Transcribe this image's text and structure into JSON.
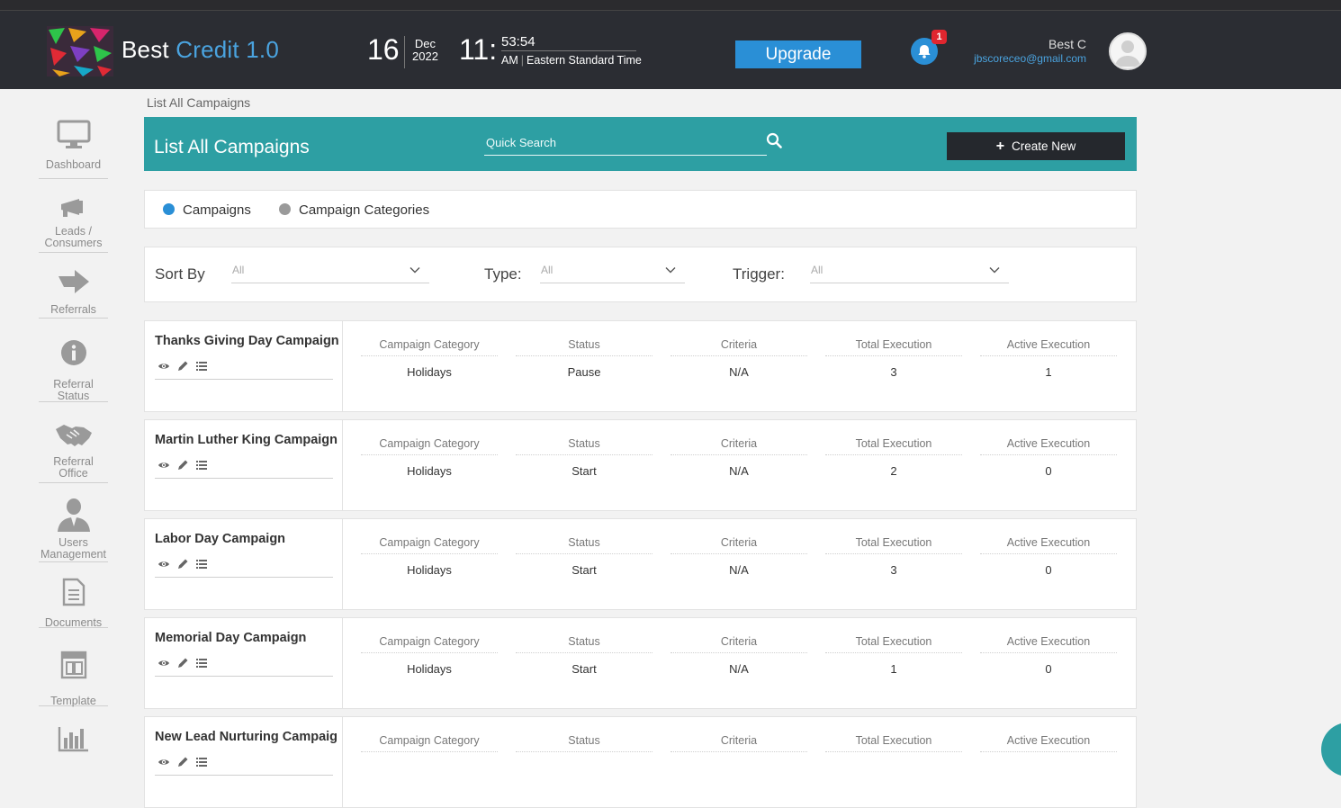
{
  "header": {
    "brand_prefix": "Best",
    "brand_suffix": "Credit 1.0",
    "date_day": "16",
    "date_month": "Dec",
    "date_year": "2022",
    "time_hour": "11:",
    "time_minsec": "53:54",
    "time_ampm": "AM",
    "time_zone": "Eastern Standard Time",
    "upgrade_label": "Upgrade",
    "notification_count": "1",
    "user_name": "Best C",
    "user_email": "jbscoreceo@gmail.com"
  },
  "sidebar": {
    "items": [
      {
        "label": "Dashboard",
        "icon": "monitor-icon"
      },
      {
        "label": "Leads / Consumers",
        "icon": "megaphone-icon"
      },
      {
        "label": "Referrals",
        "icon": "share-arrow-icon"
      },
      {
        "label": "Referral Status",
        "icon": "info-icon"
      },
      {
        "label": "Referral Office",
        "icon": "handshake-icon"
      },
      {
        "label": "Users Management",
        "icon": "user-icon"
      },
      {
        "label": "Documents",
        "icon": "document-icon"
      },
      {
        "label": "Template",
        "icon": "template-icon"
      },
      {
        "label": "",
        "icon": "bar-chart-icon"
      }
    ]
  },
  "breadcrumb": "List All Campaigns",
  "banner": {
    "title": "List All Campaigns",
    "search_placeholder": "Quick Search",
    "create_label": "Create New"
  },
  "tabs": [
    {
      "label": "Campaigns",
      "color": "#2a8fd6",
      "active": true
    },
    {
      "label": "Campaign Categories",
      "color": "#9a9a9a",
      "active": false
    }
  ],
  "filters": {
    "sort_label": "Sort By",
    "sort_value": "All",
    "type_label": "Type:",
    "type_value": "All",
    "trigger_label": "Trigger:",
    "trigger_value": "All"
  },
  "columns": [
    "Campaign Category",
    "Status",
    "Criteria",
    "Total Execution",
    "Active Execution"
  ],
  "campaigns": [
    {
      "name": "Thanks Giving Day Campaign",
      "category": "Holidays",
      "status": "Pause",
      "criteria": "N/A",
      "total": "3",
      "active": "1"
    },
    {
      "name": "Martin Luther King Campaign",
      "category": "Holidays",
      "status": "Start",
      "criteria": "N/A",
      "total": "2",
      "active": "0"
    },
    {
      "name": "Labor Day Campaign",
      "category": "Holidays",
      "status": "Start",
      "criteria": "N/A",
      "total": "3",
      "active": "0"
    },
    {
      "name": "Memorial Day Campaign",
      "category": "Holidays",
      "status": "Start",
      "criteria": "N/A",
      "total": "1",
      "active": "0"
    },
    {
      "name": "New Lead Nurturing Campaig",
      "category": "",
      "status": "",
      "criteria": "",
      "total": "",
      "active": ""
    }
  ],
  "colors": {
    "header_bg": "#2b2d33",
    "accent_blue": "#2a8fd6",
    "banner_teal": "#2d9fa3",
    "badge_red": "#e0262f"
  }
}
